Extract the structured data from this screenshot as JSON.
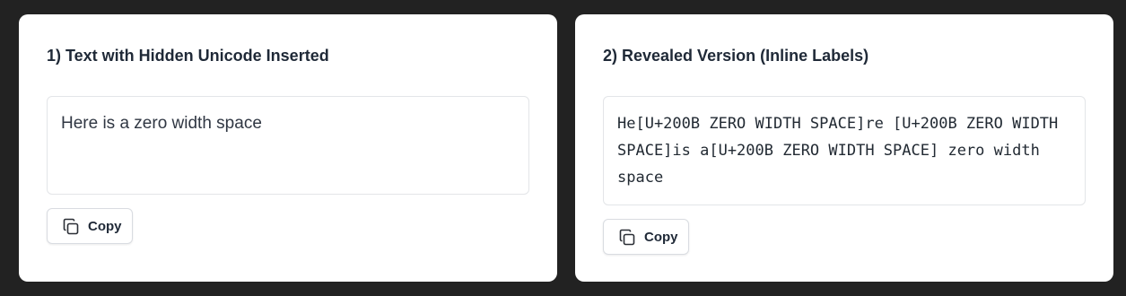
{
  "panels": [
    {
      "title": "1) Text with Hidden Unicode Inserted",
      "content": "Here is a zero width space",
      "copy_label": "Copy"
    },
    {
      "title": "2) Revealed Version (Inline Labels)",
      "content": "He[U+200B ZERO WIDTH SPACE]re [U+200B ZERO WIDTH SPACE]is a[U+200B ZERO WIDTH SPACE] zero width space",
      "copy_label": "Copy"
    }
  ],
  "icons": {
    "copy": "copy-icon"
  },
  "colors": {
    "background": "#222222",
    "card": "#ffffff",
    "text": "#1f2937",
    "border": "#e3e5e8"
  }
}
